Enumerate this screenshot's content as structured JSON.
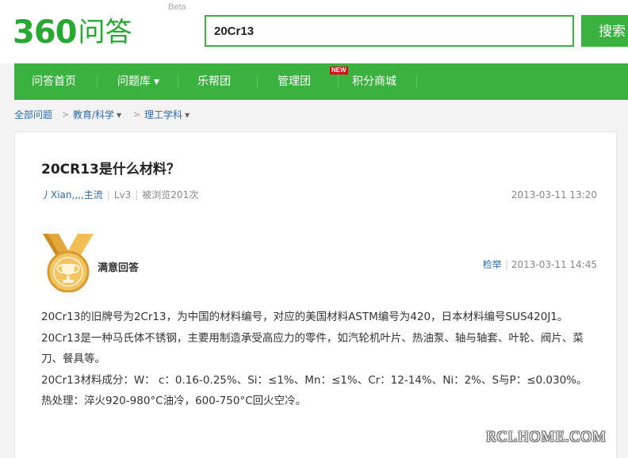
{
  "header": {
    "logo_num": "360",
    "logo_cn": "问答",
    "logo_beta": "Beta",
    "search_value": "20Cr13",
    "search_button": "搜索"
  },
  "nav": {
    "items": [
      "问答首页",
      "问题库",
      "乐帮团",
      "管理团",
      "积分商城"
    ],
    "new_badge": "NEW"
  },
  "breadcrumb": [
    "全部问题",
    "教育/科学",
    "理工学科"
  ],
  "question": {
    "title": "20CR13是什么材料？",
    "user": "丿Xian,,,,主流",
    "level": "Lv3",
    "views": "被浏览201次",
    "date": "2013-03-11 13:20"
  },
  "answer": {
    "label": "满意回答",
    "report": "检举",
    "date": "2013-03-11 14:45",
    "paragraphs": [
      "20Cr13的旧牌号为2Cr13，为中国的材料编号，对应的美国材料ASTM编号为420，日本材料编号SUS420J1。",
      "20Cr13是一种马氏体不锈钢，主要用制造承受高应力的零件，如汽轮机叶片、热油泵、轴与轴套、叶轮、阀片、菜刀、餐具等。",
      "20Cr13材料成分：W： c：0.16-0.25%、Si：≤1%、Mn：≤1%、Cr：12-14%、Ni：2%、S与P：≤0.030%。",
      "热处理：淬火920-980°C油冷，600-750°C回火空冷。"
    ]
  },
  "watermark": "RCLHOME.COM",
  "colors": {
    "brand_green": "#3bb13f",
    "link_blue": "#2b6cb0",
    "medal_gold": "#e3a73a",
    "badge_red": "#e60012"
  }
}
